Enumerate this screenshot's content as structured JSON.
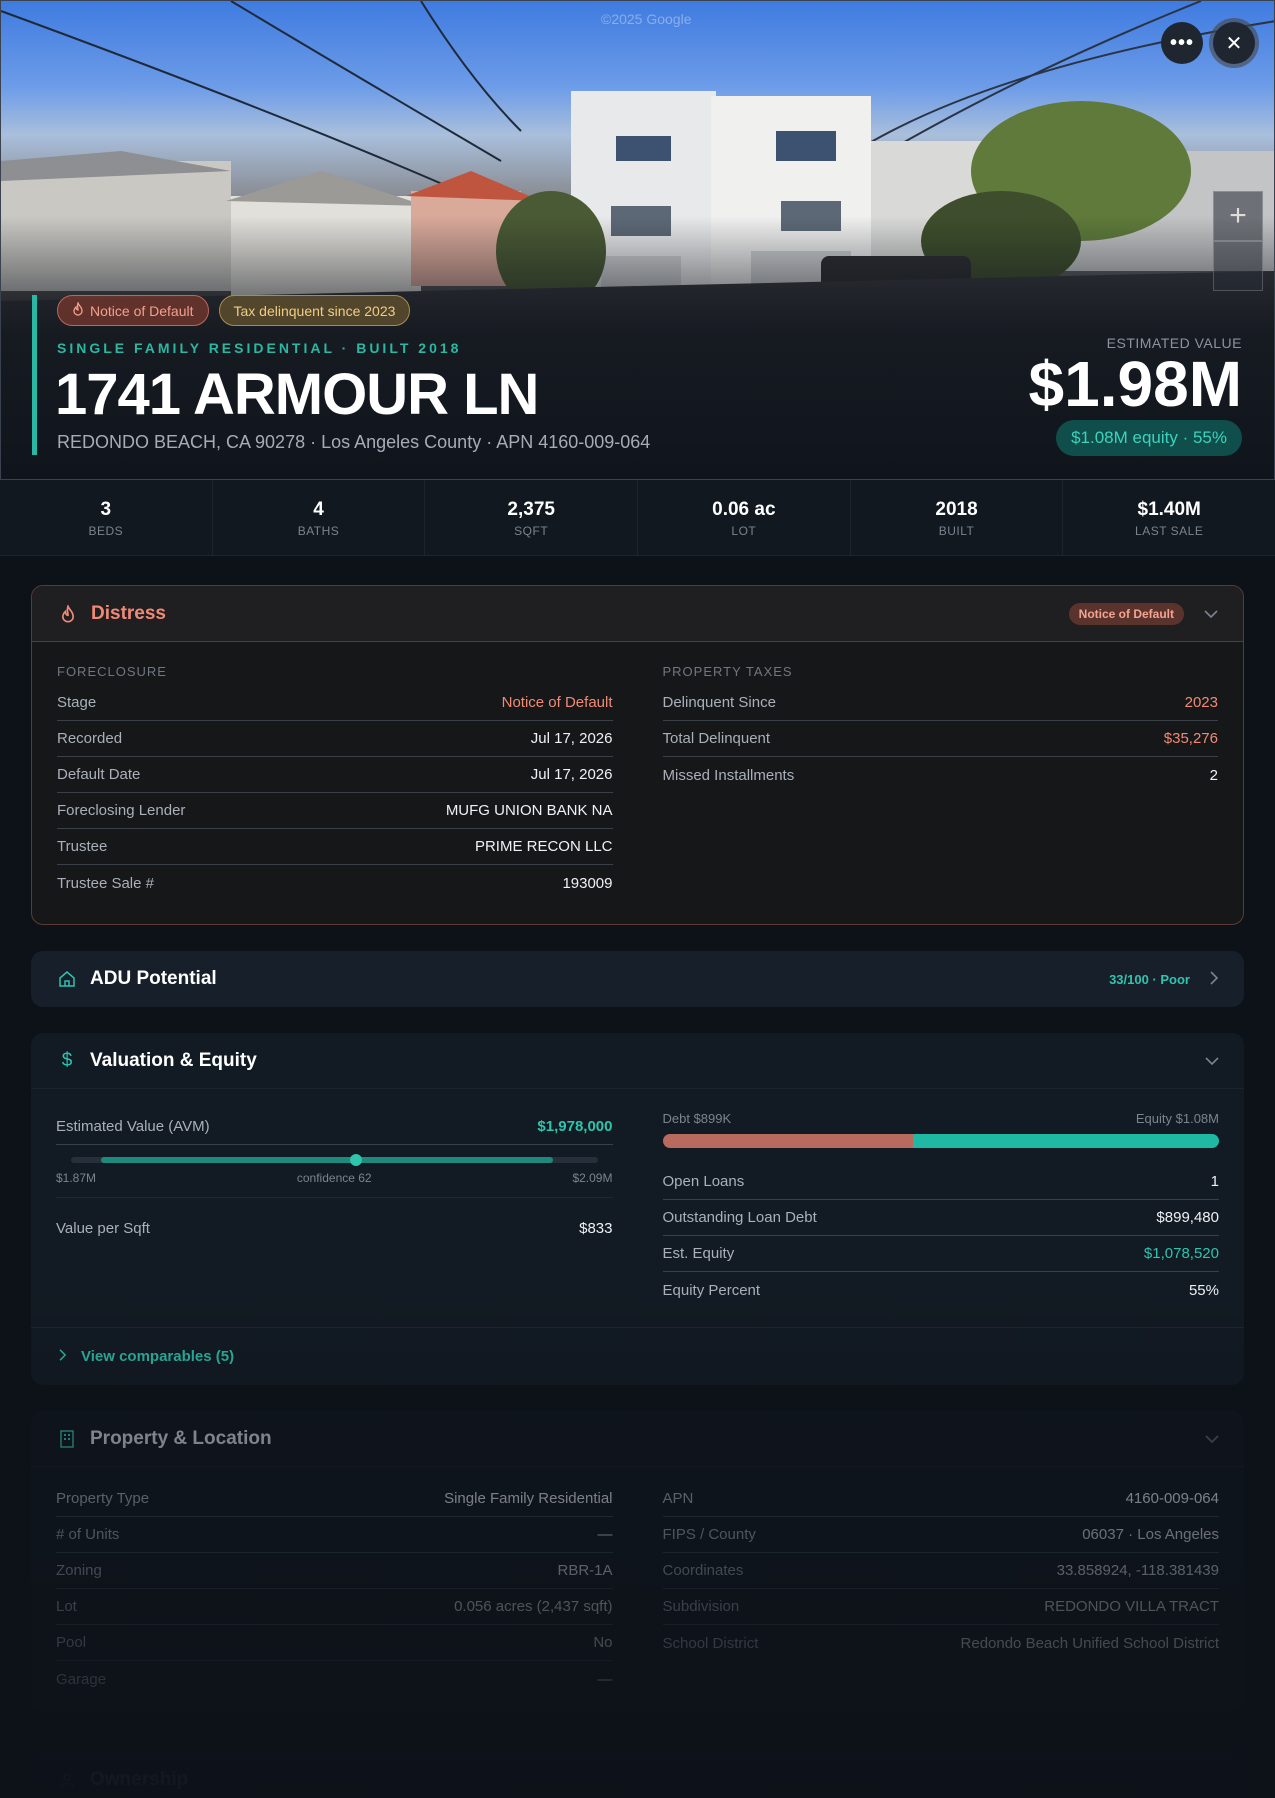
{
  "hero": {
    "watermark": "©2025 Google",
    "more_label": "•••",
    "close_label": "✕",
    "zoom_in_label": "+",
    "badges": [
      {
        "label": "Notice of Default",
        "icon": "flame-icon"
      },
      {
        "label": "Tax delinquent since 2023"
      }
    ],
    "eyebrow": "SINGLE FAMILY RESIDENTIAL · BUILT 2018",
    "address": "1741 ARMOUR LN",
    "subaddress": "REDONDO BEACH, CA 90278 · Los Angeles County · APN 4160-009-064",
    "estimated_label": "ESTIMATED VALUE",
    "estimated_value": "$1.98M",
    "equity_pill": "$1.08M equity · 55%"
  },
  "stats": [
    {
      "value": "3",
      "label": "BEDS"
    },
    {
      "value": "4",
      "label": "BATHS"
    },
    {
      "value": "2,375",
      "label": "SQFT"
    },
    {
      "value": "0.06 ac",
      "label": "LOT"
    },
    {
      "value": "2018",
      "label": "BUILT"
    },
    {
      "value": "$1.40M",
      "label": "LAST SALE"
    }
  ],
  "distress": {
    "title": "Distress",
    "badge": "Notice of Default",
    "foreclosure_label": "FORECLOSURE",
    "foreclosure": [
      {
        "k": "Stage",
        "v": "Notice of Default"
      },
      {
        "k": "Recorded",
        "v": "Jul 17, 2026"
      },
      {
        "k": "Default Date",
        "v": "Jul 17, 2026"
      },
      {
        "k": "Foreclosing Lender",
        "v": "MUFG UNION BANK NA"
      },
      {
        "k": "Trustee",
        "v": "PRIME RECON LLC"
      },
      {
        "k": "Trustee Sale #",
        "v": "193009"
      }
    ],
    "taxes_label": "PROPERTY TAXES",
    "taxes": [
      {
        "k": "Delinquent Since",
        "v": "2023"
      },
      {
        "k": "Total Delinquent",
        "v": "$35,276"
      },
      {
        "k": "Missed Installments",
        "v": "2"
      }
    ]
  },
  "adu": {
    "title": "ADU Potential",
    "score": "33/100 · Poor"
  },
  "valuation": {
    "title": "Valuation & Equity",
    "avm_label": "Estimated Value (AVM)",
    "avm_value": "$1,978,000",
    "range_low": "$1.87M",
    "confidence": "confidence 62",
    "range_high": "$2.09M",
    "sqft_label": "Value per Sqft",
    "sqft_value": "$833",
    "debt_label": "Debt $899K",
    "equity_label": "Equity $1.08M",
    "debt_fraction": 0.45,
    "rows": [
      {
        "k": "Open Loans",
        "v": "1"
      },
      {
        "k": "Outstanding Loan Debt",
        "v": "$899,480"
      },
      {
        "k": "Est. Equity",
        "v": "$1,078,520"
      },
      {
        "k": "Equity Percent",
        "v": "55%"
      }
    ],
    "comps_label": "View comparables (5)"
  },
  "property": {
    "title": "Property & Location",
    "left": [
      {
        "k": "Property Type",
        "v": "Single Family Residential"
      },
      {
        "k": "# of Units",
        "v": "—"
      },
      {
        "k": "Zoning",
        "v": "RBR-1A"
      },
      {
        "k": "Lot",
        "v": "0.056 acres (2,437 sqft)"
      },
      {
        "k": "Pool",
        "v": "No"
      },
      {
        "k": "Garage",
        "v": "—"
      }
    ],
    "right": [
      {
        "k": "APN",
        "v": "4160-009-064"
      },
      {
        "k": "FIPS / County",
        "v": "06037 · Los Angeles"
      },
      {
        "k": "Coordinates",
        "v": "33.858924, -118.381439"
      },
      {
        "k": "Subdivision",
        "v": "REDONDO VILLA TRACT"
      },
      {
        "k": "School District",
        "v": "Redondo Beach Unified School District"
      }
    ]
  },
  "ownership": {
    "title": "Ownership"
  },
  "colors": {
    "accent": "#2ab7a3",
    "distress": "#f08a76",
    "debt": "#b86a5e",
    "equity": "#1fb8a3"
  }
}
